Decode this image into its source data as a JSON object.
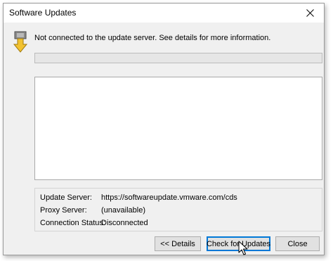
{
  "window": {
    "title": "Software Updates"
  },
  "icons": {
    "close": "close-icon",
    "status": "download-arrow-icon",
    "cursor": "mouse-pointer-icon"
  },
  "status": {
    "message": "Not connected to the update server. See details for more information."
  },
  "progress": {
    "value": 0
  },
  "details": {
    "text": ""
  },
  "info": {
    "update_server_label": "Update Server:",
    "update_server_value": "https://softwareupdate.vmware.com/cds",
    "proxy_server_label": "Proxy Server:",
    "proxy_server_value": "(unavailable)",
    "connection_status_label": "Connection Status:",
    "connection_status_value": "Disconnected"
  },
  "buttons": {
    "details": "<< Details",
    "check": "Check for Updates",
    "close": "Close"
  },
  "colors": {
    "accent": "#0078d7",
    "icon_arrow": "#f2c230",
    "icon_box": "#7a7a7a"
  }
}
